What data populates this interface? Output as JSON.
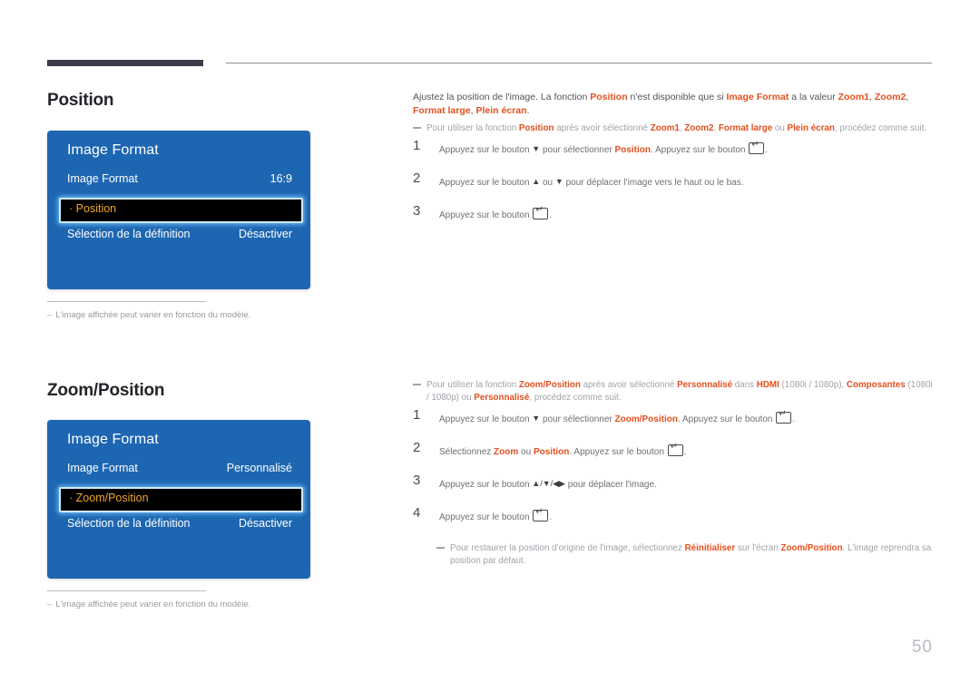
{
  "page": {
    "number": "50",
    "header_rule": "dark-bar",
    "accent_color": "#e3501f",
    "panel_color": "#1d66b2",
    "highlight_text_color": "#f0a52a"
  },
  "sections": [
    {
      "title": "Position",
      "panel": {
        "title": "Image Format",
        "rows": [
          {
            "key": "Image Format",
            "value": "16:9"
          },
          {
            "key": "Sélection de la définition",
            "value": "Désactiver"
          }
        ],
        "selected": {
          "bullet": "·",
          "label": "Position"
        }
      },
      "footnote": {
        "dash": "–",
        "text": "L'image affichée peut varier en fonction du modèle."
      },
      "lead_parts": {
        "t1": "Ajustez la position de l'image. La fonction ",
        "b1": "Position",
        "t2": " n'est disponible que si ",
        "b2": "Image Format",
        "t3": " a la valeur ",
        "b3": "Zoom1",
        "t4": ", ",
        "b4": "Zoom2",
        "t5": ", ",
        "b5": "Format large",
        "t6": ", ",
        "b6": "Plein écran",
        "t7": "."
      },
      "note_parts": {
        "t1": "Pour utiliser la fonction ",
        "b1": "Position",
        "t2": " après avoir sélectionné ",
        "b2": "Zoom1",
        "t3": ", ",
        "b3": "Zoom2",
        "t4": ", ",
        "b4": "Format large",
        "t5": " ou ",
        "b5": "Plein écran",
        "t6": ", procédez comme suit."
      },
      "steps": [
        {
          "num": "1",
          "p1": "Appuyez sur le bouton ",
          "arrow1": "▼",
          "p2": " pour sélectionner ",
          "bold": "Position",
          "p3": ". Appuyez sur le bouton ",
          "p4": "."
        },
        {
          "num": "2",
          "p1": "Appuyez sur le bouton ",
          "arrow1": "▲",
          "p2": " ou ",
          "arrow2": "▼",
          "p3": " pour déplacer l'image vers le haut ou le bas."
        },
        {
          "num": "3",
          "p1": "Appuyez sur le bouton ",
          "p4": "."
        }
      ]
    },
    {
      "title": "Zoom/Position",
      "panel": {
        "title": "Image Format",
        "rows": [
          {
            "key": "Image Format",
            "value": "Personnalisé"
          },
          {
            "key": "Sélection de la définition",
            "value": "Désactiver"
          }
        ],
        "selected": {
          "bullet": "·",
          "label": "Zoom/Position"
        }
      },
      "footnote": {
        "dash": "–",
        "text": "L'image affichée peut varier en fonction du modèle."
      },
      "note_parts": {
        "t1": "Pour utiliser la fonction ",
        "b1": "Zoom/Position",
        "t2": " après avoir sélectionné ",
        "b2": "Personnalisé",
        "t3": " dans ",
        "b3": "HDMI",
        "t4": " (1080i / 1080p), ",
        "b4": "Composantes",
        "t5": " (1080i / 1080p) ou ",
        "b5": "Personnalisé",
        "t6": ", procédez comme suit."
      },
      "steps": [
        {
          "num": "1",
          "p1": "Appuyez sur le bouton ",
          "arrow1": "▼",
          "p2": " pour sélectionner ",
          "bold": "Zoom/Position",
          "p3": ". Appuyez sur le bouton ",
          "p4": "."
        },
        {
          "num": "2",
          "p1": "Sélectionnez ",
          "bold": "Zoom",
          "p2": " ou ",
          "bold2": "Position",
          "p3": ". Appuyez sur le bouton ",
          "p4": "."
        },
        {
          "num": "3",
          "p1": "Appuyez sur le bouton ",
          "arrows": "▲/▼/◀▶",
          "p3": " pour déplacer l'image."
        },
        {
          "num": "4",
          "p1": "Appuyez sur le bouton ",
          "p4": "."
        }
      ],
      "sub_note": {
        "t1": "Pour restaurer la position d'origine de l'image, sélectionnez ",
        "b1": "Réinitialiser",
        "t2": " sur l'écran ",
        "b2": "Zoom/Position",
        "t3": ". L'image reprendra sa position par défaut."
      }
    }
  ]
}
